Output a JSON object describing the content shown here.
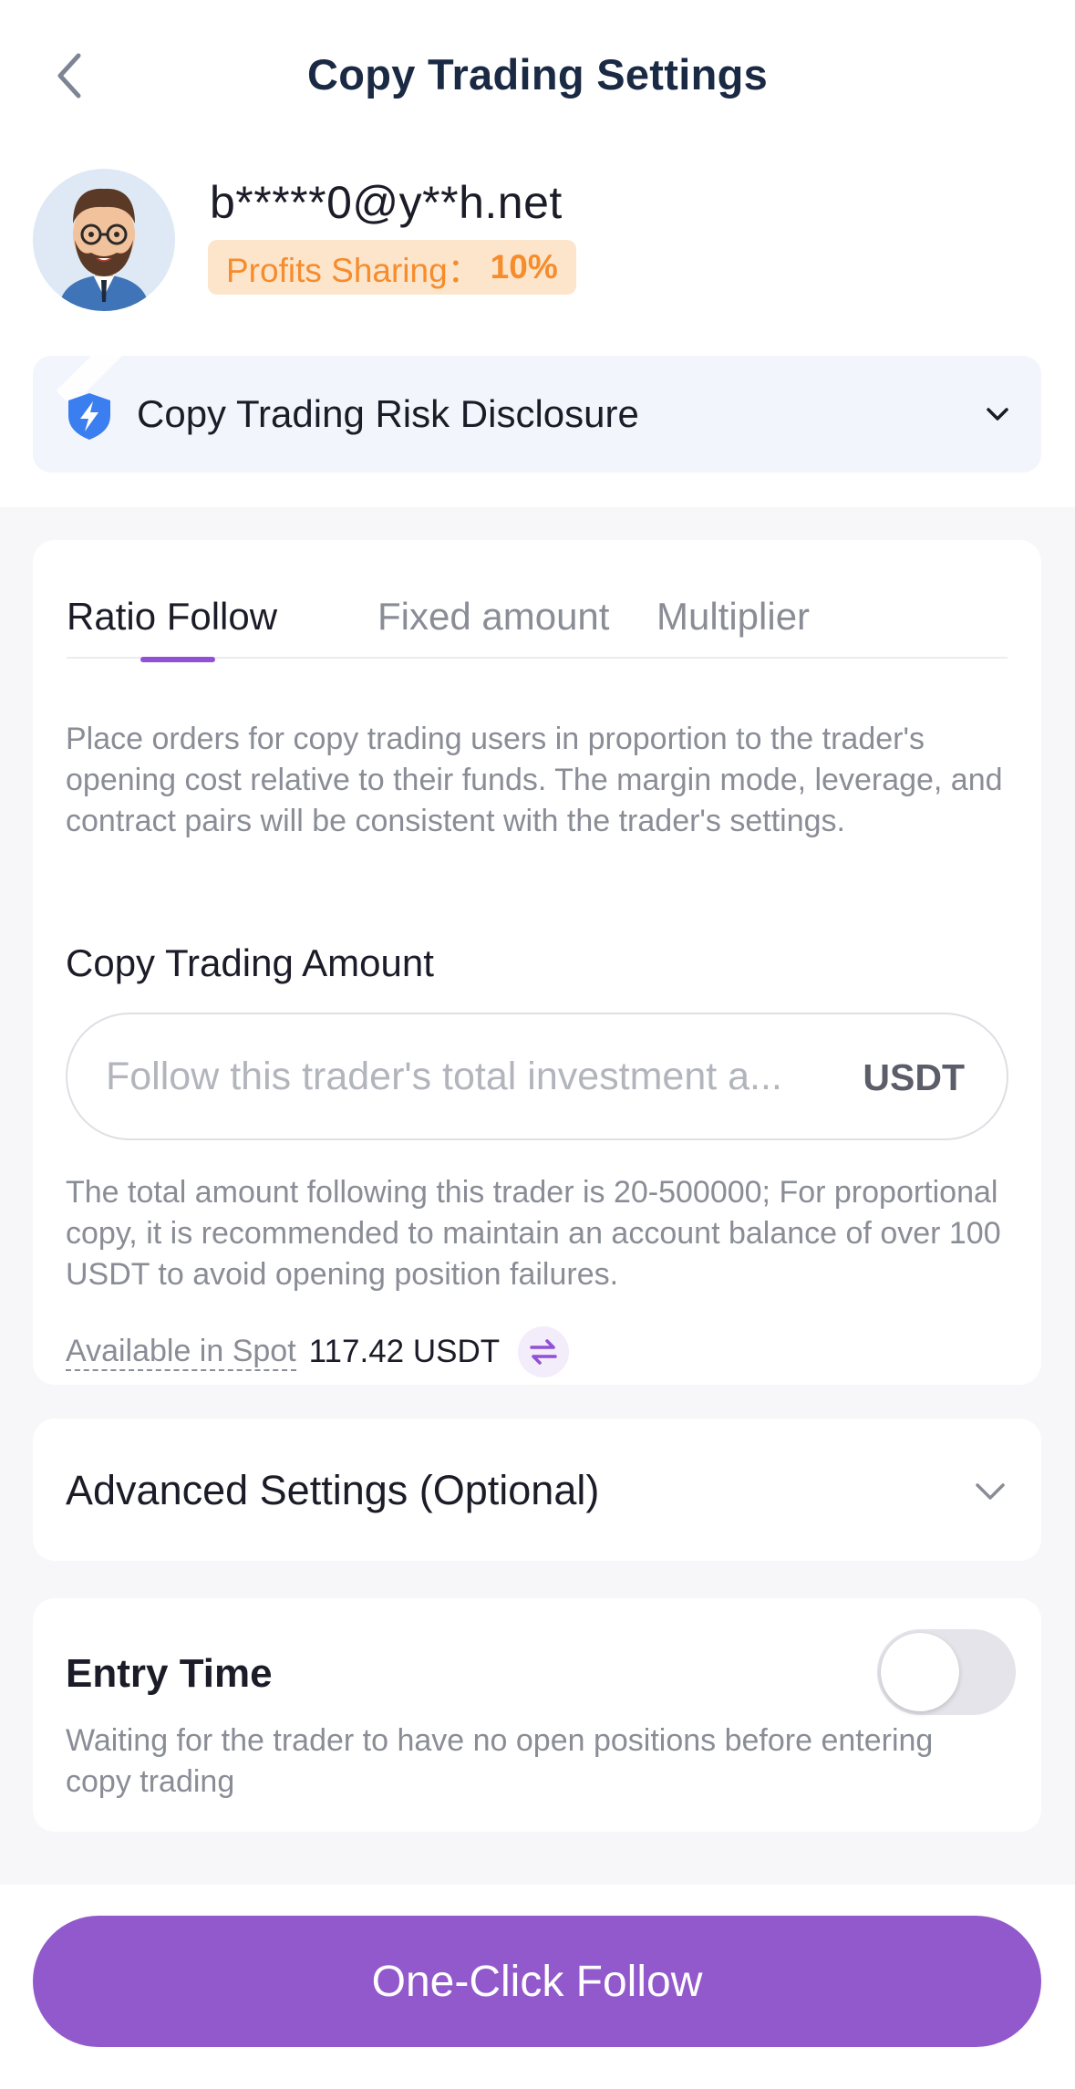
{
  "header": {
    "title": "Copy Trading Settings"
  },
  "trader": {
    "name": "b*****0@y**h.net",
    "profit_label": "Profits Sharing：",
    "profit_value": "10%"
  },
  "risk_disclosure": {
    "label": "Copy Trading Risk Disclosure"
  },
  "tabs": [
    {
      "label": "Ratio Follow",
      "active": true
    },
    {
      "label": "Fixed amount",
      "active": false
    },
    {
      "label": "Multiplier",
      "active": false
    }
  ],
  "ratio_follow": {
    "description": "Place orders for copy trading users in proportion to the trader's opening cost relative to their funds. The margin mode, leverage, and contract pairs will be consistent with the trader's settings.",
    "amount_label": "Copy Trading Amount",
    "amount_placeholder": "Follow this trader's total investment a...",
    "amount_value": "",
    "amount_unit": "USDT",
    "hint": "The total amount following this trader is 20-500000; For proportional copy, it is recommended to maintain an account balance of over 100 USDT to avoid opening position failures.",
    "available_label": "Available in Spot",
    "available_value": "117.42 USDT"
  },
  "advanced": {
    "label": "Advanced Settings (Optional)"
  },
  "entry_time": {
    "title": "Entry Time",
    "description": "Waiting for the trader to have no open positions before entering copy trading",
    "enabled": false
  },
  "footer": {
    "button_label": "One-Click Follow"
  },
  "colors": {
    "accent": "#9259cc",
    "profit_text": "#f68c2c",
    "profit_bg": "#fde5cc",
    "shield": "#3b7ef0",
    "title": "#1b2a44"
  },
  "icons": {
    "back": "chevron-left-icon",
    "risk": "shield-bolt-icon",
    "expand": "chevron-down-icon",
    "transfer": "transfer-arrows-icon",
    "avatar": "trader-avatar"
  }
}
